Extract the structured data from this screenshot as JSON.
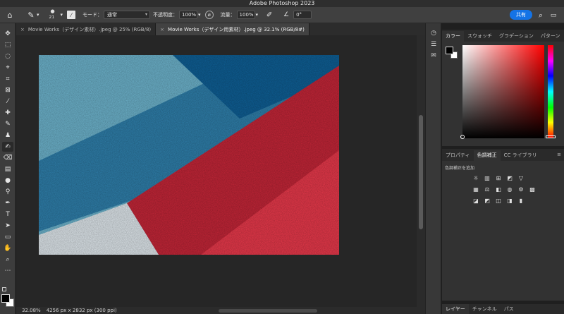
{
  "app": {
    "title": "Adobe Photoshop 2023"
  },
  "options_bar": {
    "brush_size": "21",
    "mode_label": "モード：",
    "mode_value": "通常",
    "opacity_label": "不透明度：",
    "opacity_value": "100%",
    "flow_label": "流量：",
    "flow_value": "100%",
    "angle_value": "0°",
    "share_label": "共有"
  },
  "document_tabs": [
    {
      "label": "Movie Works（デザイン素材）.jpeg @ 25% (RGB/8)",
      "active": false
    },
    {
      "label": "Movie Works（デザイン用素材）.jpeg @ 32.1% (RGB/8#)",
      "active": true
    }
  ],
  "status_bar": {
    "zoom": "32.08%",
    "info": "4256 px x 2832 px (300 ppi)"
  },
  "color_panel": {
    "tabs": [
      "カラー",
      "スウォッチ",
      "グラデーション",
      "パターン"
    ],
    "active_tab": "カラー",
    "foreground": "#000000",
    "background": "#ffffff",
    "hue_color": "#ff0000"
  },
  "adjustments_panel": {
    "tabs": [
      "プロパティ",
      "色調補正",
      "CC ライブラリ"
    ],
    "active_tab": "色調補正",
    "add_label": "色調補正を追加"
  },
  "layers_panel": {
    "tabs": [
      "レイヤー",
      "チャンネル",
      "パス"
    ],
    "active_tab": "レイヤー"
  },
  "canvas_colors": {
    "light_blue": "#6fb6cf",
    "blue": "#2f80ad",
    "dark_blue": "#0f5f95",
    "red": "#c9283a",
    "bright_red": "#e8384a",
    "white": "#e4eaee"
  }
}
